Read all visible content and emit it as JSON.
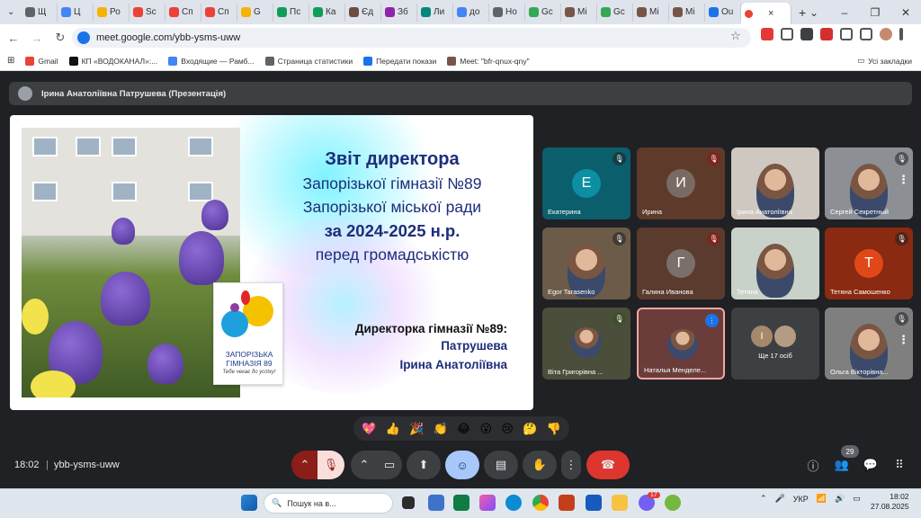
{
  "browser": {
    "tabs": [
      {
        "label": "Щ",
        "color": "#5f6368"
      },
      {
        "label": "Ц",
        "color": "#4285f4"
      },
      {
        "label": "Ро",
        "color": "#f4b400"
      },
      {
        "label": "Sc",
        "color": "#ea4335"
      },
      {
        "label": "Сп",
        "color": "#ea4335"
      },
      {
        "label": "Сп",
        "color": "#ea4335"
      },
      {
        "label": "G",
        "color": "#f4b400"
      },
      {
        "label": "Пс",
        "color": "#0f9d58"
      },
      {
        "label": "Ка",
        "color": "#0f9d58"
      },
      {
        "label": "Єд",
        "color": "#6d4c41"
      },
      {
        "label": "Зб",
        "color": "#8e24aa"
      },
      {
        "label": "Ли",
        "color": "#00897b"
      },
      {
        "label": "до",
        "color": "#4285f4"
      },
      {
        "label": "Но",
        "color": "#5f6368"
      },
      {
        "label": "Gc",
        "color": "#34a853"
      },
      {
        "label": "Mi",
        "color": "#795548"
      },
      {
        "label": "Gc",
        "color": "#34a853"
      },
      {
        "label": "Mi",
        "color": "#795548"
      },
      {
        "label": "Mi",
        "color": "#795548"
      },
      {
        "label": "Ou",
        "color": "#1a73e8"
      }
    ],
    "active_tab_close": "×",
    "new_tab": "+",
    "window_controls": [
      "⌄",
      "–",
      "❐",
      "✕"
    ],
    "url": "meet.google.com/ybb-ysms-uww",
    "bookmarks": [
      {
        "label": "Gmail",
        "color": "#ea4335"
      },
      {
        "label": "КП «ВОДОКАНАЛ»:...",
        "color": "#111111"
      },
      {
        "label": "Входящие — Рамб...",
        "color": "#4285f4"
      },
      {
        "label": "Страница статистики",
        "color": "#5f6368"
      },
      {
        "label": "Передати покази",
        "color": "#1a73e8"
      },
      {
        "label": "Meet: \"bfr-qnux-qny\"",
        "color": "#795548"
      }
    ],
    "all_bookmarks": "Усі закладки"
  },
  "meet": {
    "presenter_banner": "Ірина Анатоліївна Патрушева (Презентація)",
    "slide": {
      "line1": "Звіт директора",
      "line2": "Запорізької гімназії №89",
      "line3": "Запорізької міської ради",
      "line4": "за 2024-2025 н.р.",
      "line5": "перед громадськістю",
      "sign1": "Директорка гімназії №89:",
      "sign2": "Патрушева",
      "sign3": "Ірина Анатоліївна",
      "logo_text": "ЗАПОРІЗЬКА ГІМНАЗІЯ 89",
      "logo_motto": "Тебе чекає до успіху!"
    },
    "participants": [
      {
        "name": "Екатерина",
        "initial": "Е",
        "bg": "#0b5e6b",
        "avatar": "#0d8fa3"
      },
      {
        "name": "Ирина",
        "initial": "И",
        "bg": "#5d3a2a",
        "avatar": "#7a6a64"
      },
      {
        "name": "Ірина Анатоліївна",
        "initial": "",
        "bg": "#cfc8c0"
      },
      {
        "name": "Сергей Секретный",
        "initial": "",
        "bg": "#8c9095"
      },
      {
        "name": "Egor Tarasenko",
        "initial": "",
        "bg": "#6b5b48"
      },
      {
        "name": "Галина Иванова",
        "initial": "Г",
        "bg": "#5a3b2e",
        "avatar": "#7a6f6a"
      },
      {
        "name": "Тетяна",
        "initial": "",
        "bg": "#c9d2c9"
      },
      {
        "name": "Тетяна Самошенко",
        "initial": "Т",
        "bg": "#8a2a10",
        "avatar": "#e0481a"
      },
      {
        "name": "Віта Григорівна ...",
        "initial": "",
        "bg": "#4a4e3a"
      },
      {
        "name": "Наталья Менделе...",
        "initial": "",
        "bg": "#6a3d3a"
      },
      {
        "name": "Ще 17 осіб",
        "initial": "І",
        "bg": "#3c4043",
        "avatar": "#a5896a"
      },
      {
        "name": "Ольга Вікторівна...",
        "initial": "",
        "bg": "#7f7f7f"
      }
    ],
    "reactions": [
      "💖",
      "👍",
      "🎉",
      "👏",
      "😂",
      "😮",
      "😢",
      "🤔",
      "👎"
    ],
    "time": "18:02",
    "separator": "|",
    "meeting_code": "ybb-ysms-uww",
    "participants_count": "29"
  },
  "taskbar": {
    "search_placeholder": "Пошук на в...",
    "language": "УКР",
    "time": "18:02",
    "date": "27.08.2025",
    "chrome_badge": "17"
  }
}
